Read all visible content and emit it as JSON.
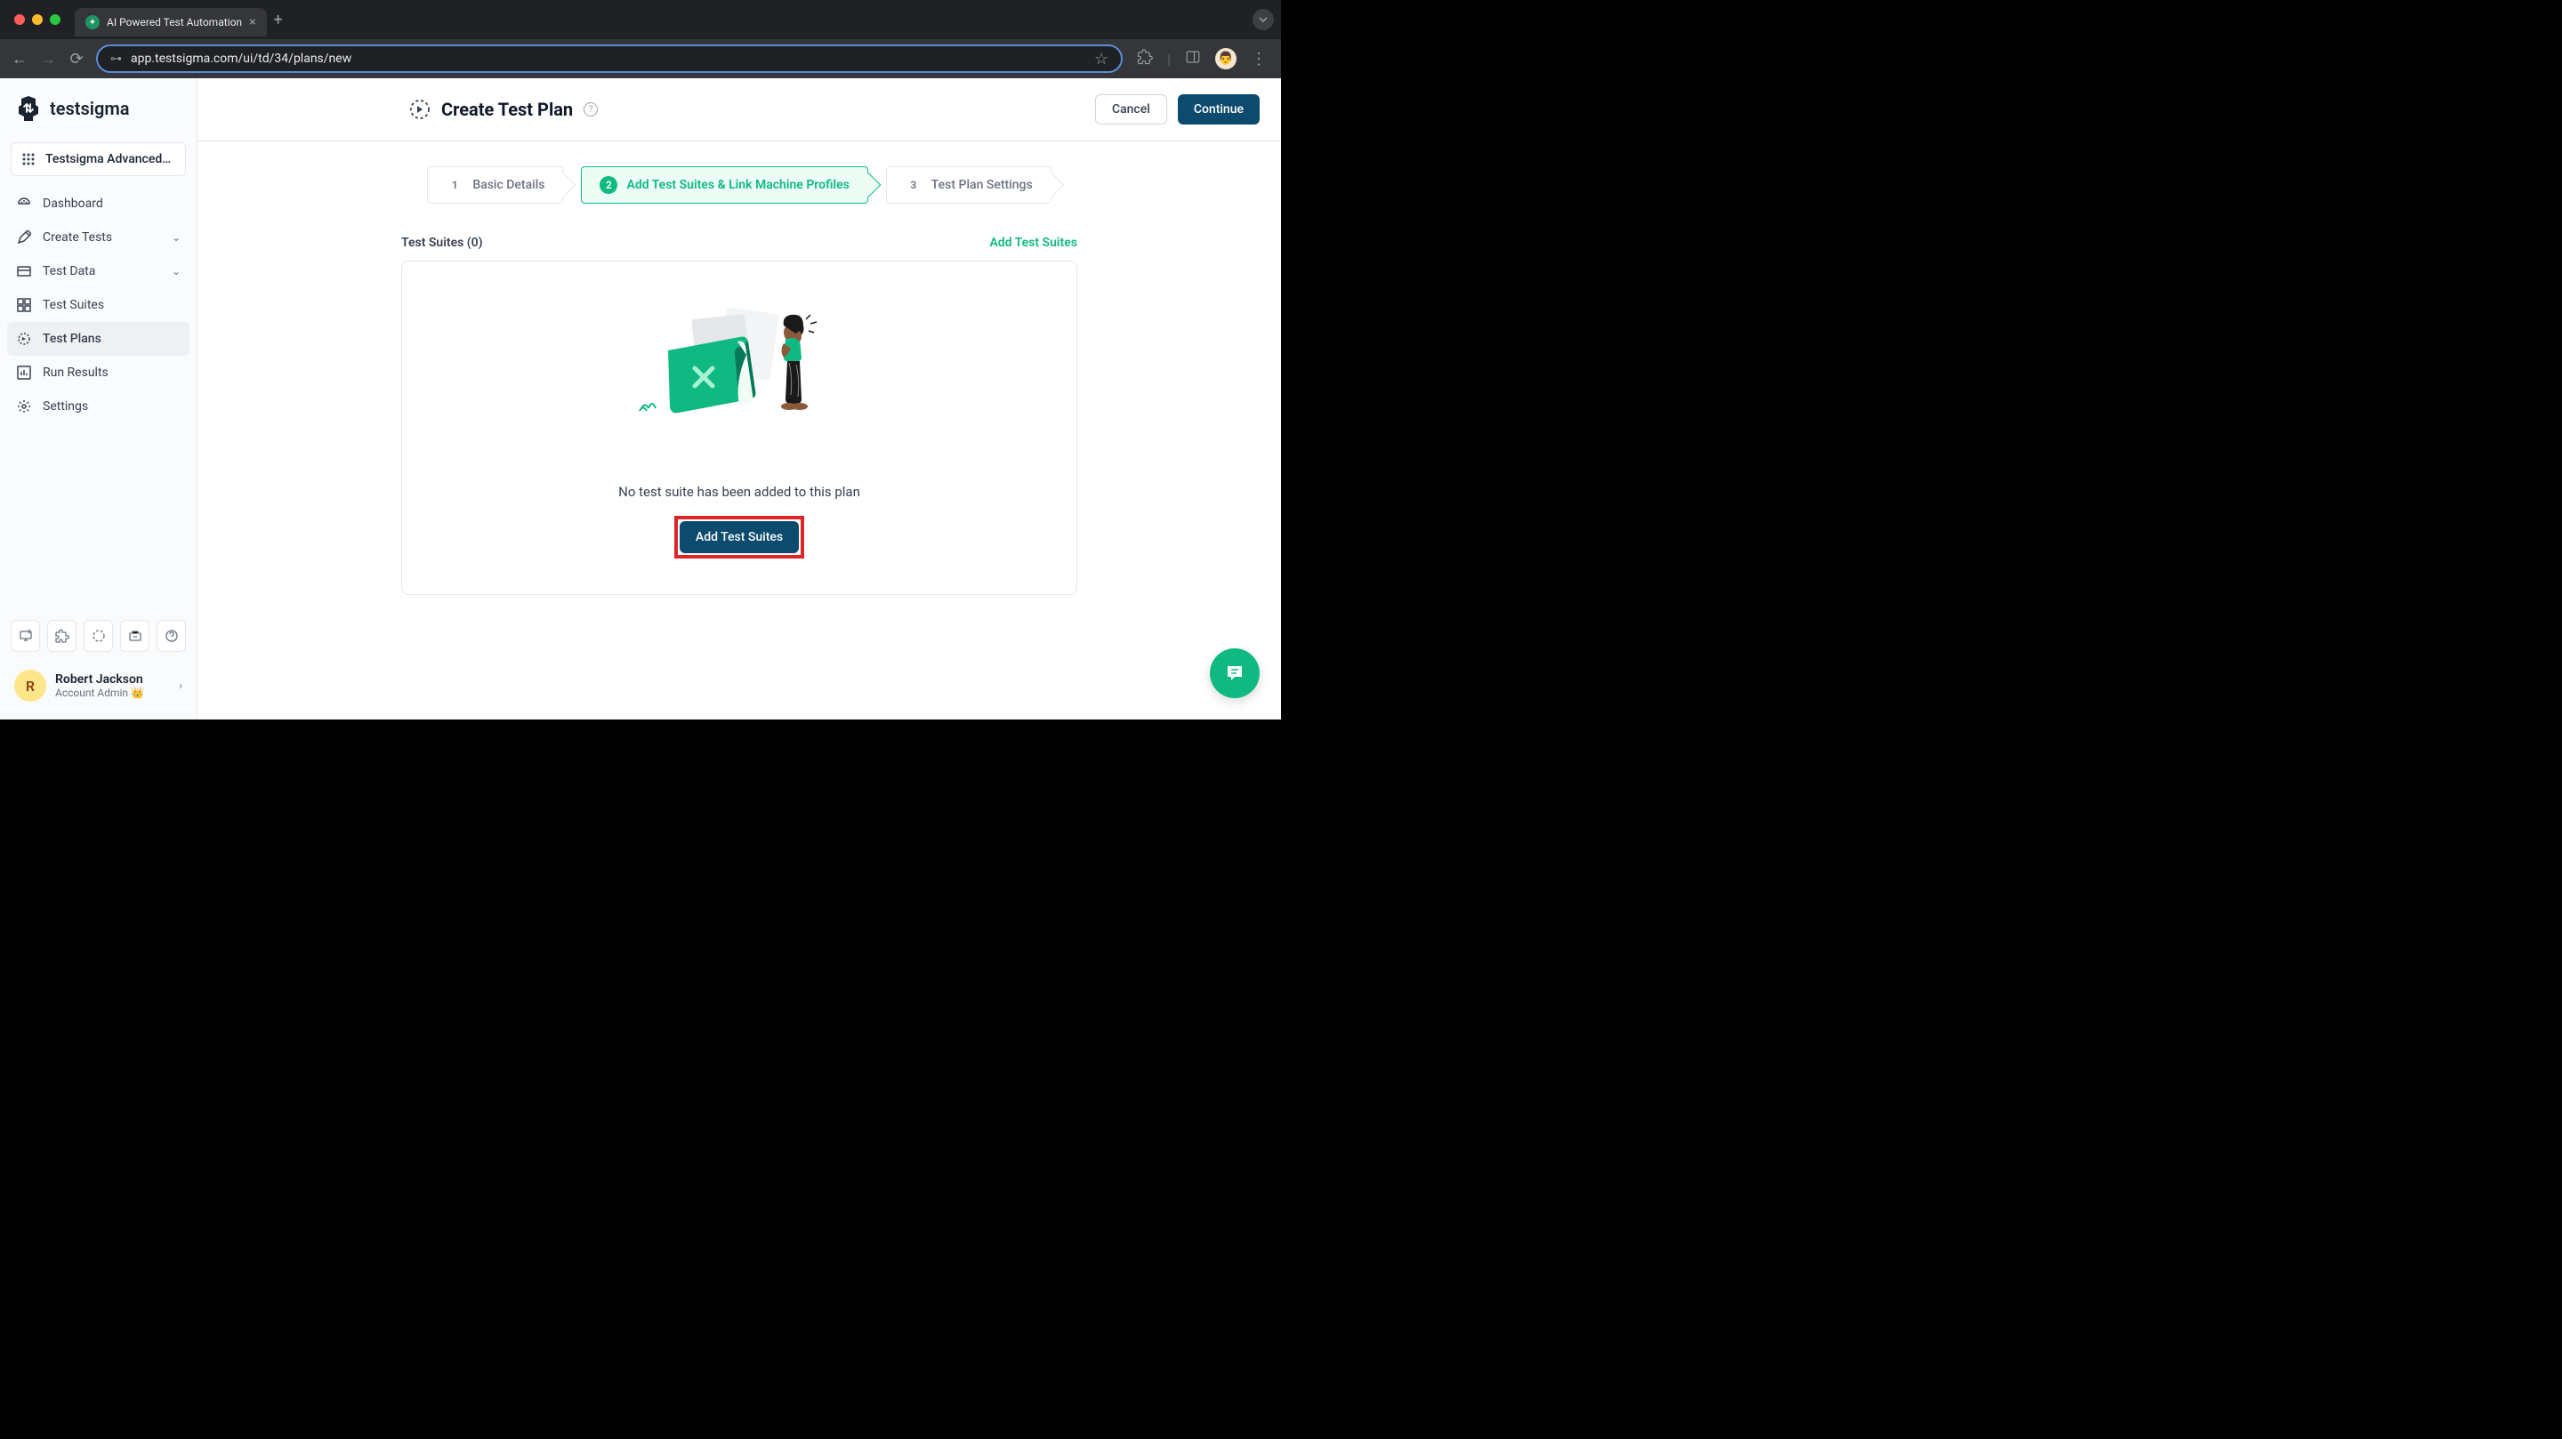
{
  "browser": {
    "tabTitle": "AI Powered Test Automation",
    "url": "app.testsigma.com/ui/td/34/plans/new"
  },
  "sidebar": {
    "logo": "testsigma",
    "workspace": "Testsigma Advanced…",
    "nav": [
      {
        "label": "Dashboard",
        "icon": "dashboard"
      },
      {
        "label": "Create Tests",
        "icon": "edit",
        "expandable": true
      },
      {
        "label": "Test Data",
        "icon": "folder",
        "expandable": true
      },
      {
        "label": "Test Suites",
        "icon": "grid"
      },
      {
        "label": "Test Plans",
        "icon": "target",
        "active": true
      },
      {
        "label": "Run Results",
        "icon": "chart"
      },
      {
        "label": "Settings",
        "icon": "gear"
      }
    ],
    "user": {
      "initial": "R",
      "name": "Robert Jackson",
      "role": "Account Admin 👑"
    }
  },
  "header": {
    "title": "Create Test Plan",
    "cancelLabel": "Cancel",
    "continueLabel": "Continue"
  },
  "stepper": {
    "steps": [
      {
        "num": "1",
        "label": "Basic Details"
      },
      {
        "num": "2",
        "label": "Add Test Suites & Link Machine Profiles",
        "active": true
      },
      {
        "num": "3",
        "label": "Test Plan Settings"
      }
    ]
  },
  "suites": {
    "title": "Test Suites (0)",
    "addLinkLabel": "Add Test Suites",
    "emptyMessage": "No test suite has been added to this plan",
    "addButtonLabel": "Add Test Suites"
  }
}
